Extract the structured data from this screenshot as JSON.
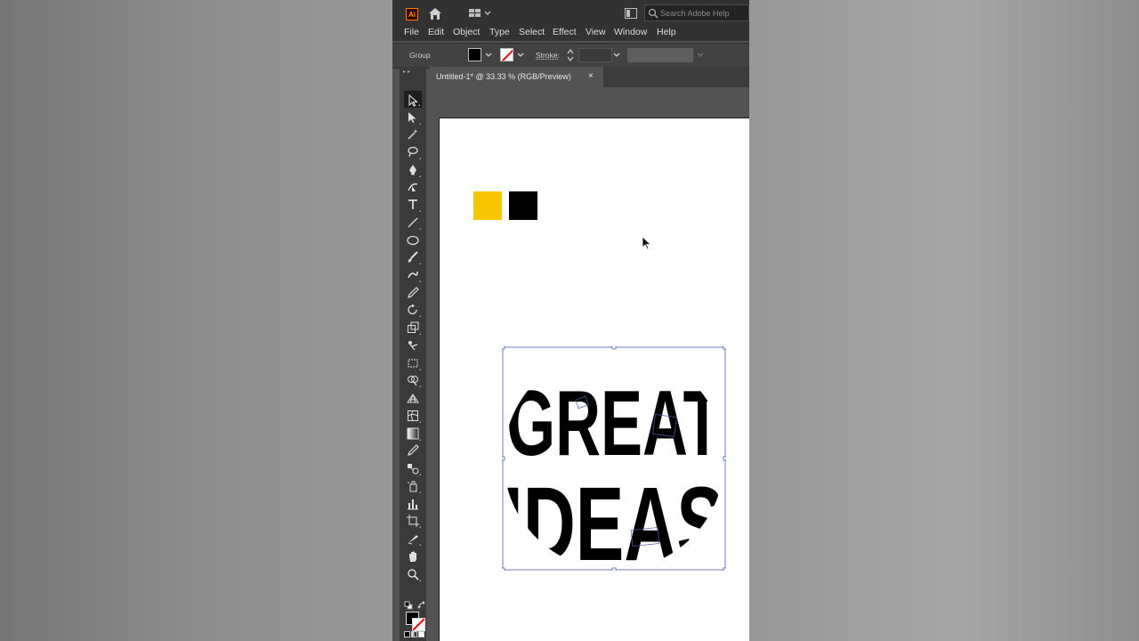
{
  "app": {
    "logo_text": "Ai",
    "search_placeholder": "Search Adobe Help"
  },
  "menu": {
    "items": [
      "File",
      "Edit",
      "Object",
      "Type",
      "Select",
      "Effect",
      "View",
      "Window",
      "Help"
    ]
  },
  "control_bar": {
    "selection_label": "Group",
    "stroke_label": "Stroke:",
    "fill_color": "#000000",
    "stroke_color": "none"
  },
  "document": {
    "tab_title": "Untitled-1* @ 33.33 % (RGB/Preview)",
    "close_glyph": "×"
  },
  "canvas": {
    "swatches": [
      "#f7c600",
      "#000000"
    ],
    "artwork_lines": [
      "GREAT",
      "IDEAS"
    ]
  },
  "toolbar": {
    "tools": [
      "selection-tool-icon",
      "direct-selection-tool-icon",
      "magic-wand-tool-icon",
      "lasso-tool-icon",
      "pen-tool-icon",
      "curvature-tool-icon",
      "type-tool-icon",
      "line-segment-tool-icon",
      "ellipse-tool-icon",
      "paintbrush-tool-icon",
      "shaper-tool-icon",
      "pencil-tool-icon",
      "rotate-tool-icon",
      "scale-tool-icon",
      "puppet-warp-tool-icon",
      "free-transform-tool-icon",
      "shape-builder-tool-icon",
      "perspective-grid-tool-icon",
      "mesh-tool-icon",
      "gradient-tool-icon",
      "eyedropper-tool-icon",
      "blend-tool-icon",
      "symbol-sprayer-tool-icon",
      "column-graph-tool-icon",
      "artboard-tool-icon",
      "slice-tool-icon",
      "hand-tool-icon",
      "zoom-tool-icon"
    ]
  }
}
